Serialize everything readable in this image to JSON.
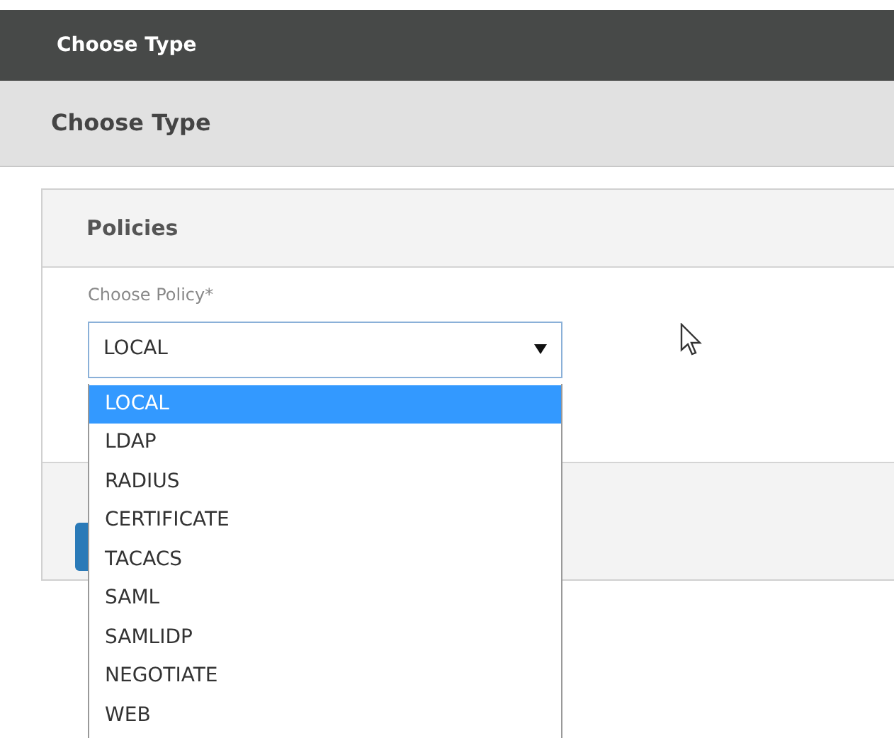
{
  "title_bar": {
    "title": "Choose Type"
  },
  "header": {
    "title": "Choose Type"
  },
  "panel": {
    "title": "Policies",
    "field": {
      "label": "Choose Policy*",
      "value": "LOCAL",
      "expanded": true,
      "options": [
        {
          "label": "LOCAL",
          "selected": true
        },
        {
          "label": "LDAP",
          "selected": false
        },
        {
          "label": "RADIUS",
          "selected": false
        },
        {
          "label": "CERTIFICATE",
          "selected": false
        },
        {
          "label": "TACACS",
          "selected": false
        },
        {
          "label": "SAML",
          "selected": false
        },
        {
          "label": "SAMLIDP",
          "selected": false
        },
        {
          "label": "NEGOTIATE",
          "selected": false
        },
        {
          "label": "WEB",
          "selected": false
        }
      ]
    }
  }
}
